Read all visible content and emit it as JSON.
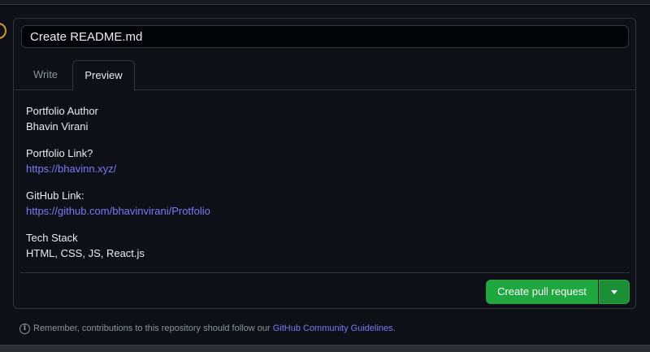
{
  "editor": {
    "title_value": "Create README.md",
    "tabs": [
      {
        "label": "Write",
        "active": false
      },
      {
        "label": "Preview",
        "active": true
      }
    ]
  },
  "preview": {
    "author_label": "Portfolio Author",
    "author_value": "Bhavin Virani",
    "portfolio_label": "Portfolio Link?",
    "portfolio_link": "https://bhavinn.xyz/",
    "github_label": "GitHub Link:",
    "github_link": "https://github.com/bhavinvirani/Protfolio",
    "stack_label": "Tech Stack",
    "stack_value": "HTML, CSS, JS, React.js"
  },
  "actions": {
    "create_pr_label": "Create pull request",
    "dropdown_icon": "chevron-down-icon"
  },
  "footer_note": {
    "icon": "info-icon",
    "text_before": "Remember, contributions to this repository should follow our",
    "link_text": "GitHub Community Guidelines",
    "text_after": "."
  },
  "colors": {
    "background": "#0d1117",
    "border": "#30363d",
    "link": "#7b78f5",
    "primary_button": "#1fa83f"
  }
}
